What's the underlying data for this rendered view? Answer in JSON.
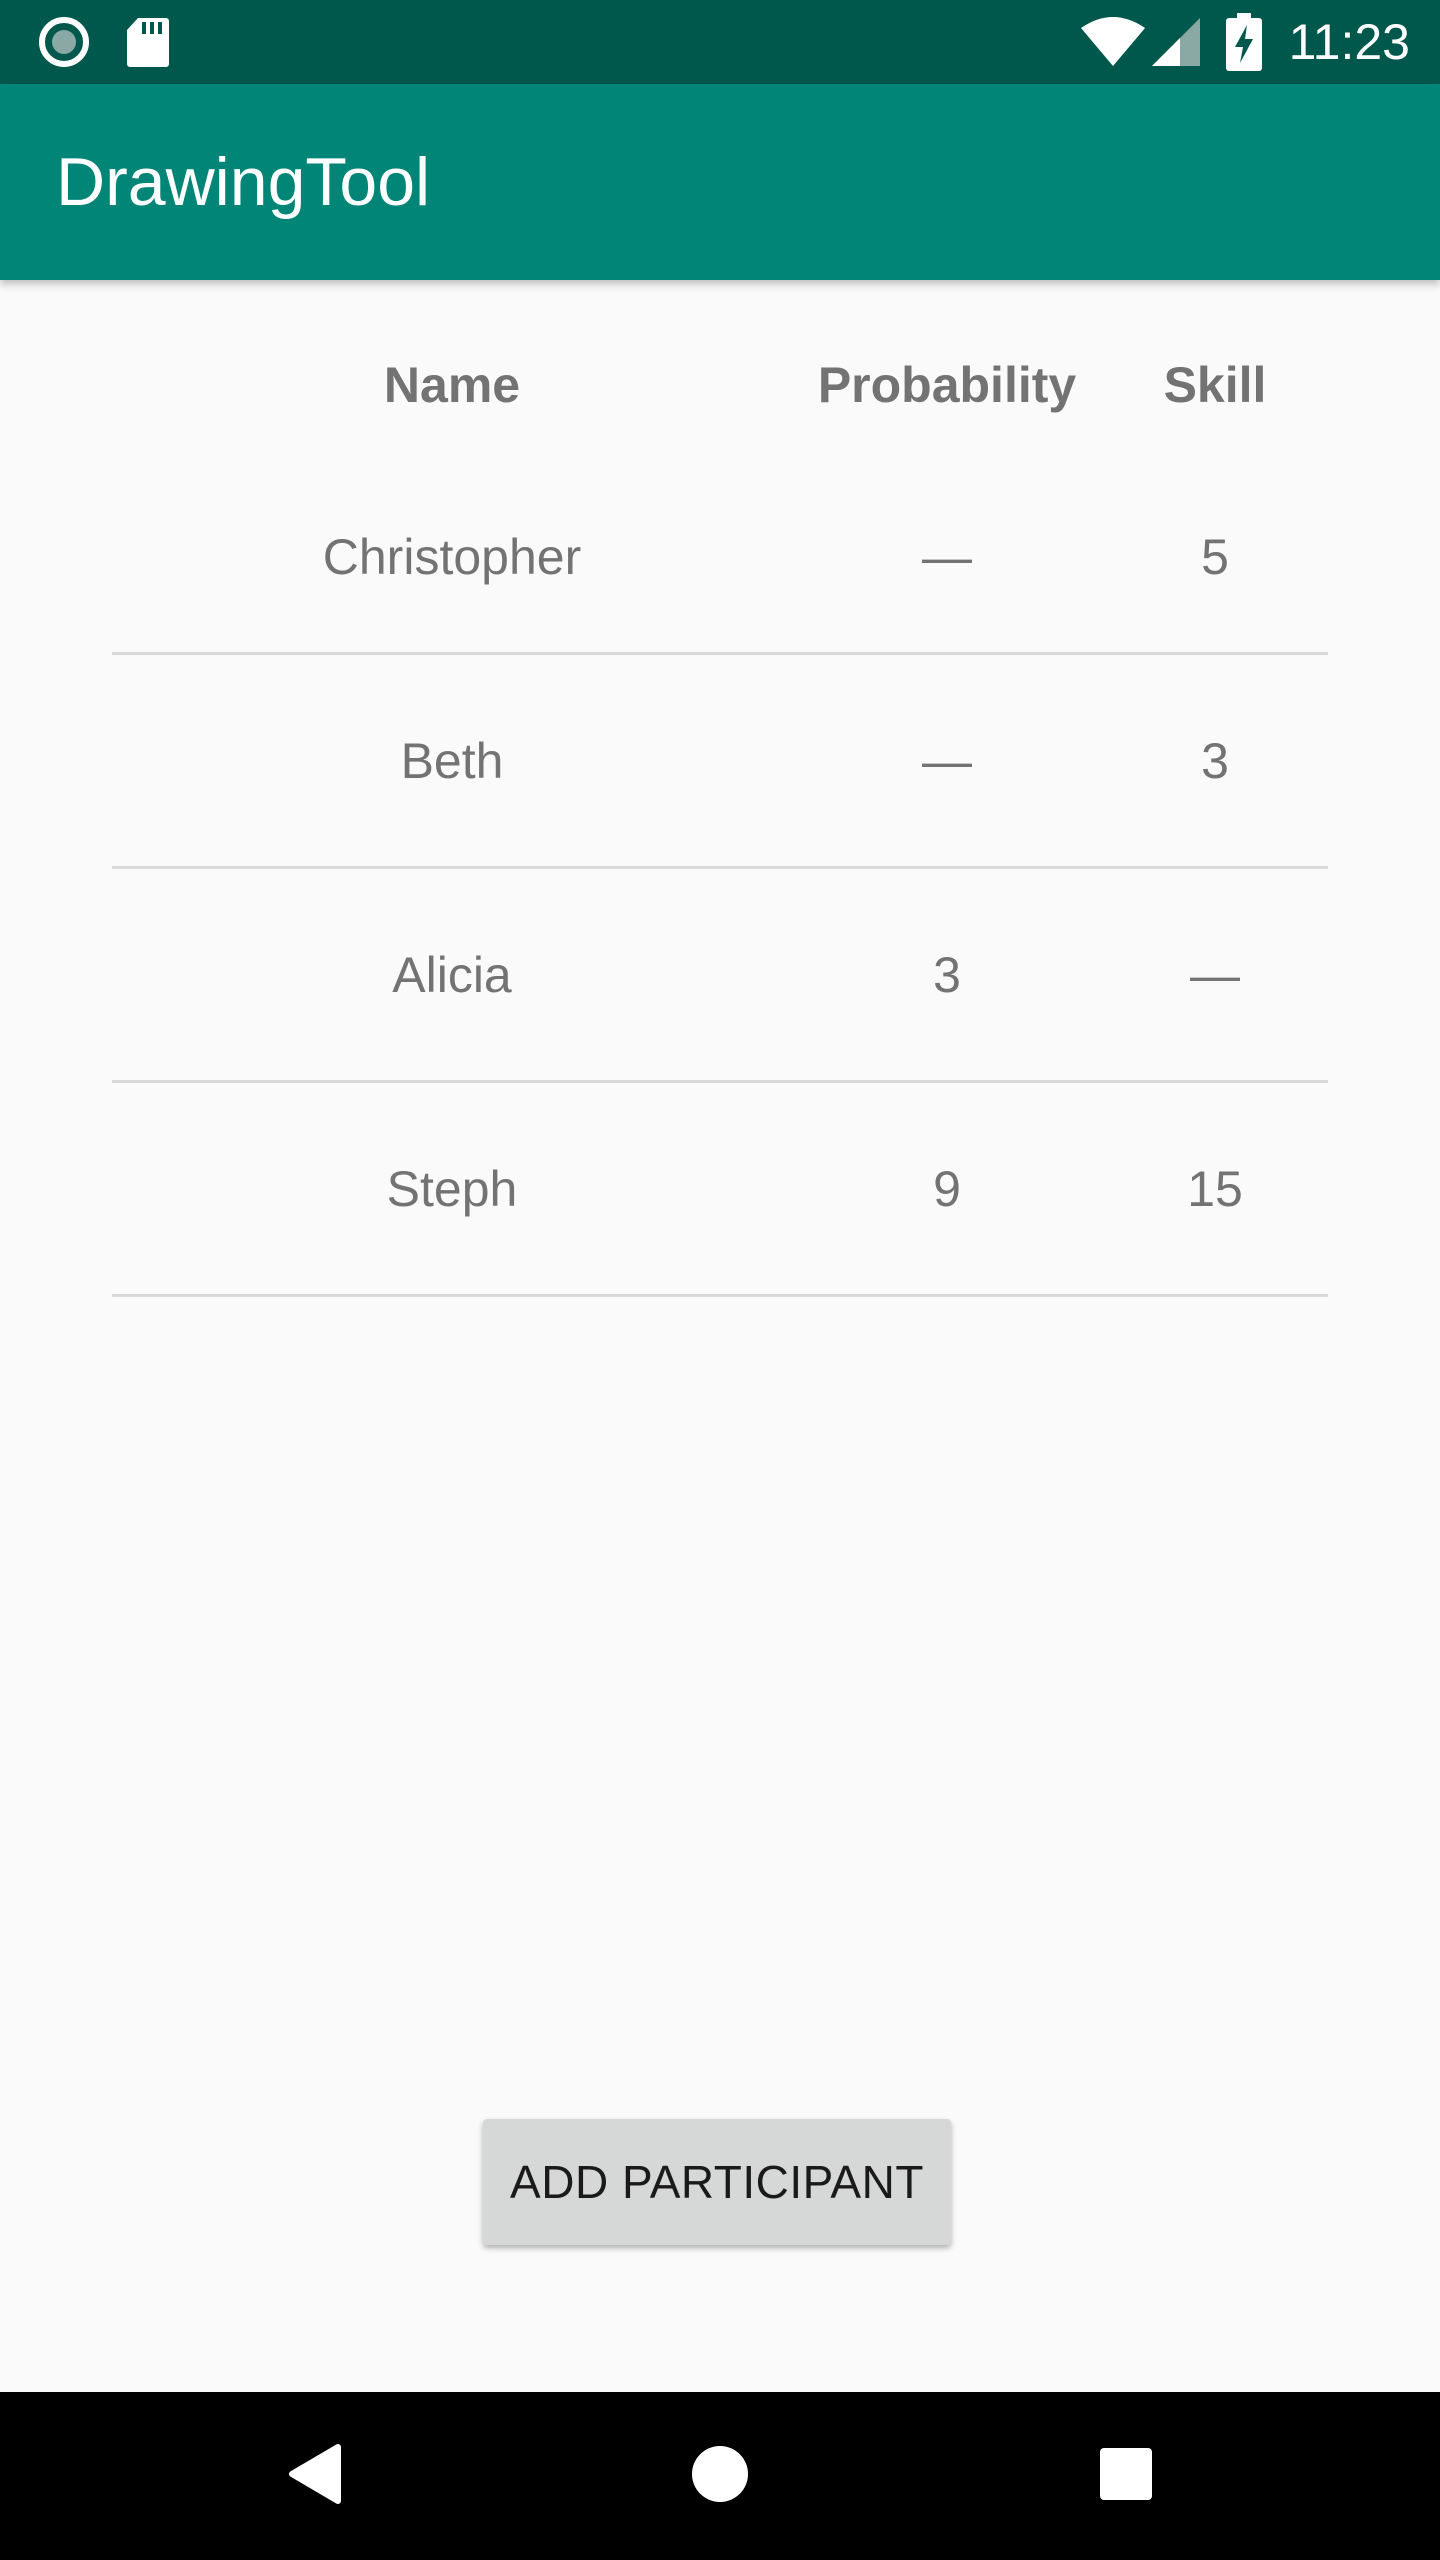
{
  "status_bar": {
    "time": "11:23",
    "icons": [
      "record-icon",
      "sd-card-icon",
      "wifi-icon",
      "signal-icon",
      "battery-charging-icon"
    ]
  },
  "app_bar": {
    "title": "DrawingTool"
  },
  "table": {
    "headers": {
      "name": "Name",
      "probability": "Probability",
      "skill": "Skill"
    },
    "rows": [
      {
        "name": "Christopher",
        "probability": "—",
        "skill": "5"
      },
      {
        "name": "Beth",
        "probability": "—",
        "skill": "3"
      },
      {
        "name": "Alicia",
        "probability": "3",
        "skill": "—"
      },
      {
        "name": "Steph",
        "probability": "9",
        "skill": "15"
      }
    ]
  },
  "actions": {
    "add_participant_label": "ADD PARTICIPANT"
  },
  "nav_bar": {
    "buttons": [
      "back-icon",
      "home-icon",
      "recents-icon"
    ]
  },
  "colors": {
    "status_bar": "#00574b",
    "app_bar": "#008577",
    "background": "#fafafa",
    "text": "#737373",
    "divider": "#d9d9d9",
    "button": "#d6d7d7"
  }
}
